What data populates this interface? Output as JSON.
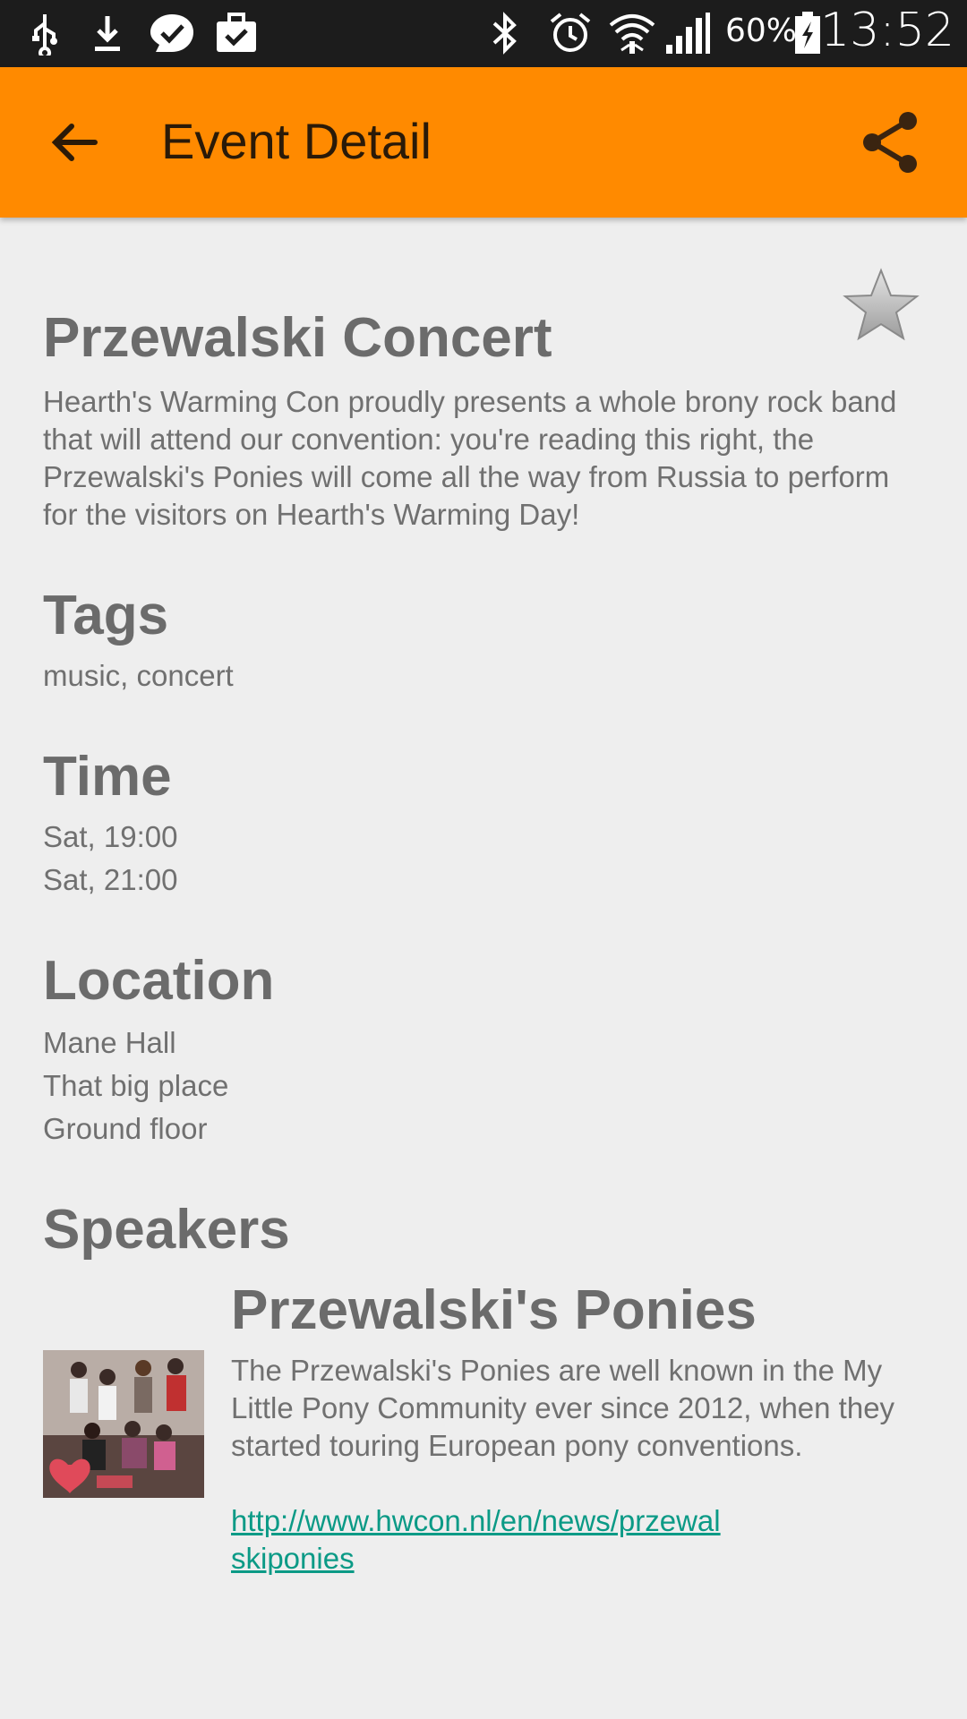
{
  "status_bar": {
    "battery_percent": "60%",
    "clock": "13:52",
    "icons": [
      "usb-icon",
      "download-icon",
      "check-bubble-icon",
      "briefcase-check-icon",
      "bluetooth-icon",
      "alarm-icon",
      "wifi-icon",
      "signal-icon",
      "battery-charging-icon"
    ]
  },
  "app_bar": {
    "title": "Event Detail",
    "back_icon": "arrow-back-icon",
    "share_icon": "share-icon",
    "color": "#ff8a00"
  },
  "event": {
    "title": "Przewalski Concert",
    "description": "Hearth's Warming Con proudly presents a whole brony rock band that will attend our convention: you're reading this right, the Przewalski's Ponies will come all the way from Russia to perform for the visitors on Hearth's Warming Day!",
    "favorite_icon": "star-icon"
  },
  "sections": {
    "tags": {
      "heading": "Tags",
      "value": "music, concert"
    },
    "time": {
      "heading": "Time",
      "lines": [
        "Sat, 19:00",
        "Sat, 21:00"
      ]
    },
    "location": {
      "heading": "Location",
      "lines": [
        "Mane Hall",
        "That big place",
        "Ground floor"
      ]
    },
    "speakers": {
      "heading": "Speakers"
    }
  },
  "speaker": {
    "name": "Przewalski's Ponies",
    "bio": "The Przewalski's Ponies are well known in the My Little Pony Community ever since 2012, when they started touring European pony conventions.",
    "link": "http://www.hwcon.nl/en/news/przewalskiponies",
    "link_color": "#0b9a86"
  }
}
